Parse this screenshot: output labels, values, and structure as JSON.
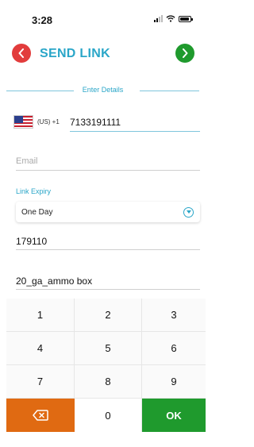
{
  "status_bar": {
    "time": "3:28"
  },
  "header": {
    "title": "SEND LINK",
    "back_icon": "chevron-left-icon",
    "next_icon": "chevron-right-icon"
  },
  "section": {
    "label": "Enter Details"
  },
  "phone": {
    "country_code": "(US) +1",
    "number": "7133191111",
    "flag_icon": "us-flag-icon"
  },
  "email": {
    "placeholder": "Email",
    "value": ""
  },
  "link_expiry": {
    "label": "Link Expiry",
    "selected": "One Day"
  },
  "code_field": {
    "value": "179110"
  },
  "name_field": {
    "value": "20_ga_ammo box"
  },
  "keypad": {
    "keys": [
      "1",
      "2",
      "3",
      "4",
      "5",
      "6",
      "7",
      "8",
      "9"
    ],
    "zero": "0",
    "ok": "OK",
    "delete_icon": "backspace-icon"
  },
  "colors": {
    "accent": "#2aa6c8",
    "back": "#e23c3c",
    "confirm": "#1f9a2d",
    "delete": "#e06a12"
  }
}
